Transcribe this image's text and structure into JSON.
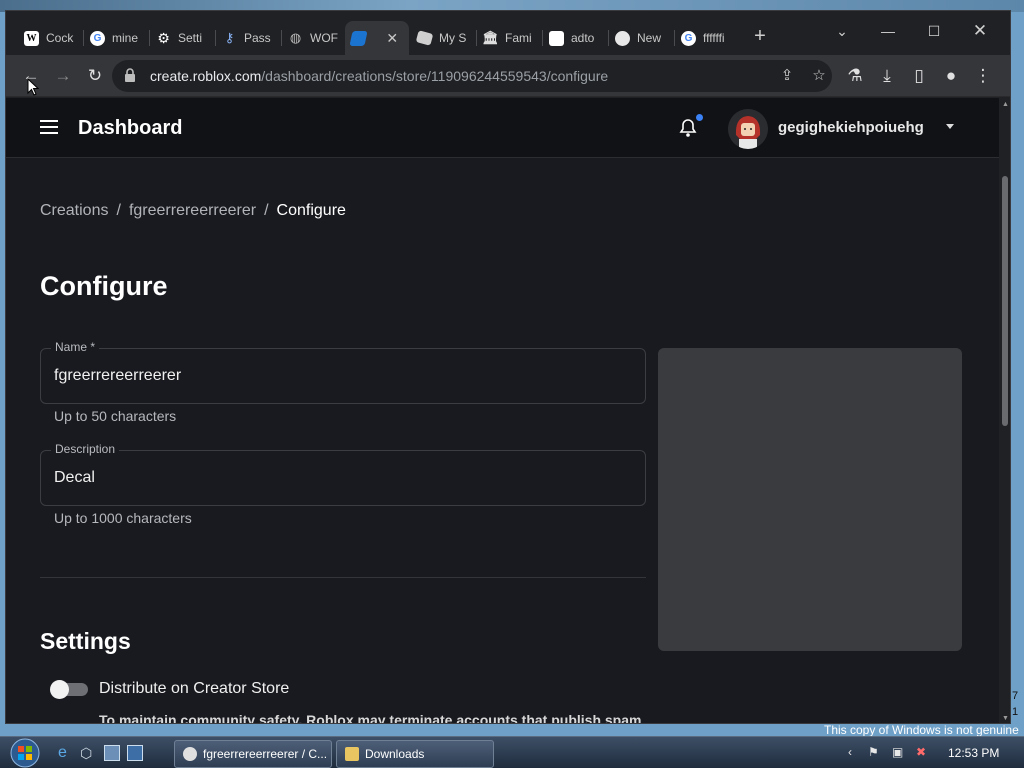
{
  "browser": {
    "tabs": [
      {
        "label": "Cock",
        "icon": "wikipedia-icon"
      },
      {
        "label": "mine",
        "icon": "google-icon"
      },
      {
        "label": "Setti",
        "icon": "gear-icon"
      },
      {
        "label": "Pass",
        "icon": "key-icon"
      },
      {
        "label": "WOF",
        "icon": "globe-icon"
      },
      {
        "label": " ",
        "icon": "roblox-studio-icon",
        "active": true
      },
      {
        "label": "My S",
        "icon": "roblox-icon"
      },
      {
        "label": "Fami",
        "icon": "bank-icon"
      },
      {
        "label": "adto",
        "icon": "blank-page-icon"
      },
      {
        "label": "New",
        "icon": "chrome-icon"
      },
      {
        "label": "ffffffi",
        "icon": "google-icon"
      }
    ],
    "new_tab": "+",
    "url_host": "create.roblox.com",
    "url_path": "/dashboard/creations/store/119096244559543/configure"
  },
  "app": {
    "title": "Dashboard",
    "username": "gegighekiehpoiuehg"
  },
  "breadcrumb": {
    "items": [
      "Creations",
      "fgreerrereerreerer"
    ],
    "current": "Configure",
    "separator": "/"
  },
  "page": {
    "heading": "Configure",
    "name_label": "Name *",
    "name_value": "fgreerrereerreerer",
    "name_hint": "Up to 50 characters",
    "desc_label": "Description",
    "desc_value": "Decal",
    "desc_hint": "Up to 1000 characters",
    "settings_heading": "Settings",
    "distribute_label": "Distribute on Creator Store",
    "distribute_on": false,
    "notice": "To maintain community safety, Roblox may terminate accounts that publish spam"
  },
  "taskbar": {
    "task1": "fgreerrereerreerer / C...",
    "task2": "Downloads",
    "clock": "12:53 PM",
    "watermark": "This copy of Windows is not genuine",
    "side": [
      "7",
      "1"
    ]
  },
  "colors": {
    "accent": "#3b82f6",
    "page_bg": "#191a1f",
    "appbar_bg": "#111216"
  }
}
